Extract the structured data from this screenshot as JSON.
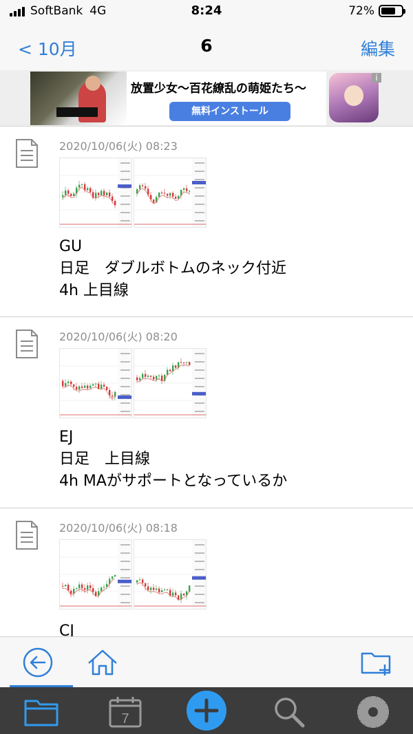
{
  "status_bar": {
    "carrier": "SoftBank",
    "network": "4G",
    "time": "8:24",
    "battery_percent": "72%",
    "battery_level": 0.72
  },
  "nav": {
    "back_label": "< 10月",
    "title": "6",
    "edit_label": "編集"
  },
  "ad": {
    "title": "放置少女〜百花繚乱の萌姫たち〜",
    "button_label": "無料インストール",
    "info_icon": "i"
  },
  "notes": [
    {
      "date": "2020/10/06(火) 08:23",
      "lines": [
        "GU",
        "日足　ダブルボトムのネック付近",
        "4h 上目線"
      ]
    },
    {
      "date": "2020/10/06(火) 08:20",
      "lines": [
        "EJ",
        "日足　上目線",
        "4h  MAがサポートとなっているか"
      ]
    },
    {
      "date": "2020/10/06(火) 08:18",
      "lines": [
        "CJ"
      ]
    }
  ],
  "toolbar": {
    "icons": [
      "back-arrow-icon",
      "home-icon",
      "add-folder-icon"
    ]
  },
  "tabbar": {
    "calendar_day": "7",
    "icons": [
      "folder-icon",
      "calendar-icon",
      "plus-icon",
      "search-icon",
      "gear-icon"
    ]
  },
  "colors": {
    "accent": "#2f7fd8",
    "tabbar_bg": "#3c3c3c",
    "ad_button": "#4a7fe2"
  }
}
